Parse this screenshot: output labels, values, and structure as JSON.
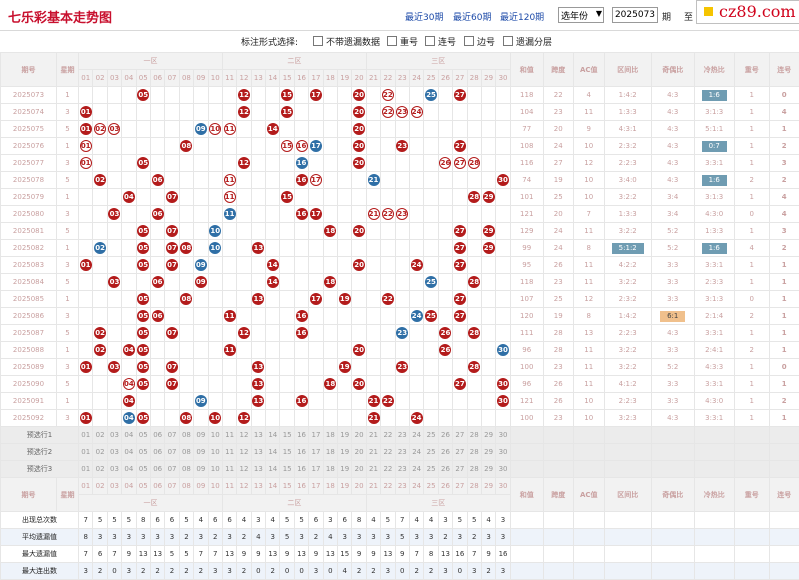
{
  "header": {
    "title": "七乐彩基本走势图",
    "links": [
      "最近30期",
      "最近60期",
      "最近120期"
    ],
    "year_select": "选年份",
    "period_value": "2025073",
    "period_unit": "期",
    "to_label": "至",
    "logo_text": "cz89.com"
  },
  "options": {
    "label": "标注形式选择:",
    "items": [
      "不带遗漏数据",
      "重号",
      "连号",
      "边号",
      "遗漏分层"
    ]
  },
  "cols": {
    "period": "期号",
    "week": "星期",
    "zone1": "一区",
    "zone2": "二区",
    "zone3": "三区",
    "sum": "和值",
    "span": "跨度",
    "ac": "AC值",
    "zone_ratio": "区间比",
    "odd_even": "奇偶比",
    "hot_cold": "冷热比",
    "repeat": "重号",
    "consec": "连号"
  },
  "numbers": [
    "01",
    "02",
    "03",
    "04",
    "05",
    "06",
    "07",
    "08",
    "09",
    "10",
    "11",
    "12",
    "13",
    "14",
    "15",
    "16",
    "17",
    "18",
    "19",
    "20",
    "21",
    "22",
    "23",
    "24",
    "25",
    "26",
    "27",
    "28",
    "29",
    "30"
  ],
  "rows": [
    {
      "p": "2025073",
      "w": "1",
      "balls": [
        5,
        12,
        15,
        17,
        20,
        22,
        27,
        25
      ],
      "blue": [
        25
      ],
      "ring": [
        22
      ],
      "sum": "118",
      "span": "22",
      "ac": "4",
      "zr": "1:4:2",
      "oe": "4:3",
      "hc": "1:6",
      "hch": 1,
      "rep": "1",
      "con": "0"
    },
    {
      "p": "2025074",
      "w": "3",
      "balls": [
        1,
        12,
        15,
        20,
        22,
        23,
        24
      ],
      "ring": [
        22,
        23,
        24
      ],
      "sum": "104",
      "span": "23",
      "ac": "11",
      "zr": "1:3:3",
      "oe": "4:3",
      "hc": "3:1:3",
      "rep": "1",
      "con": "4"
    },
    {
      "p": "2025075",
      "w": "5",
      "balls": [
        1,
        2,
        3,
        9,
        10,
        11,
        14,
        20
      ],
      "blue": [
        9
      ],
      "ring": [
        2,
        3,
        10,
        11
      ],
      "sum": "77",
      "span": "20",
      "ac": "9",
      "zr": "4:3:1",
      "oe": "4:3",
      "hc": "5:1:1",
      "rep": "1",
      "con": "1"
    },
    {
      "p": "2025076",
      "w": "1",
      "balls": [
        1,
        8,
        15,
        16,
        17,
        20,
        23,
        27
      ],
      "blue": [
        17
      ],
      "ring": [
        1,
        15,
        16
      ],
      "sum": "108",
      "span": "24",
      "ac": "10",
      "zr": "2:3:2",
      "oe": "4:3",
      "hc": "0:7",
      "hch": 1,
      "rep": "1",
      "con": "2"
    },
    {
      "p": "2025077",
      "w": "3",
      "balls": [
        1,
        5,
        12,
        16,
        20,
        26,
        27,
        28
      ],
      "blue": [
        16
      ],
      "ring": [
        1,
        26,
        27,
        28
      ],
      "sum": "116",
      "span": "27",
      "ac": "12",
      "zr": "2:2:3",
      "oe": "4:3",
      "hc": "3:3:1",
      "rep": "1",
      "con": "3"
    },
    {
      "p": "2025078",
      "w": "5",
      "balls": [
        2,
        6,
        11,
        16,
        17,
        21,
        30
      ],
      "blue": [
        21
      ],
      "ring": [
        11,
        17
      ],
      "sum": "74",
      "span": "19",
      "ac": "10",
      "zr": "3:4:0",
      "oe": "4:3",
      "hc": "1:6",
      "hch": 1,
      "rep": "2",
      "con": "2"
    },
    {
      "p": "2025079",
      "w": "1",
      "balls": [
        4,
        7,
        11,
        15,
        28,
        29
      ],
      "ring": [
        11
      ],
      "sum": "101",
      "span": "25",
      "ac": "10",
      "zr": "3:2:2",
      "oe": "3:4",
      "hc": "3:1:3",
      "rep": "1",
      "con": "4"
    },
    {
      "p": "2025080",
      "w": "3",
      "balls": [
        3,
        6,
        11,
        16,
        17,
        21,
        22,
        23
      ],
      "blue": [
        11
      ],
      "ring": [
        21,
        22,
        23
      ],
      "sum": "121",
      "span": "20",
      "ac": "7",
      "zr": "1:3:3",
      "oe": "3:4",
      "hc": "4:3:0",
      "rep": "0",
      "con": "4"
    },
    {
      "p": "2025081",
      "w": "5",
      "balls": [
        5,
        7,
        10,
        18,
        20,
        27,
        29
      ],
      "blue": [
        10
      ],
      "sum": "129",
      "span": "24",
      "ac": "11",
      "zr": "3:2:2",
      "oe": "5:2",
      "hc": "1:3:3",
      "rep": "1",
      "con": "3"
    },
    {
      "p": "2025082",
      "w": "1",
      "balls": [
        2,
        5,
        7,
        8,
        10,
        13,
        27,
        29
      ],
      "blue": [
        2,
        10
      ],
      "sum": "99",
      "span": "24",
      "ac": "8",
      "zr": "5:1:2",
      "oe": "5:2",
      "hc": "1:6",
      "hch": 1,
      "zrh": 1,
      "rep": "4",
      "con": "2"
    },
    {
      "p": "2025083",
      "w": "3",
      "balls": [
        1,
        5,
        7,
        9,
        14,
        20,
        24,
        27
      ],
      "blue": [
        9
      ],
      "sum": "95",
      "span": "26",
      "ac": "11",
      "zr": "4:2:2",
      "oe": "3:3",
      "hc": "3:3:1",
      "rep": "1",
      "con": "1"
    },
    {
      "p": "2025084",
      "w": "5",
      "balls": [
        3,
        6,
        9,
        14,
        18,
        25,
        28
      ],
      "blue": [
        25
      ],
      "sum": "118",
      "span": "23",
      "ac": "11",
      "zr": "3:2:2",
      "oe": "3:3",
      "hc": "2:3:3",
      "rep": "1",
      "con": "1"
    },
    {
      "p": "2025085",
      "w": "1",
      "balls": [
        5,
        8,
        13,
        17,
        19,
        22,
        27
      ],
      "sum": "107",
      "span": "25",
      "ac": "12",
      "zr": "2:3:2",
      "oe": "3:3",
      "hc": "3:1:3",
      "rep": "0",
      "con": "1"
    },
    {
      "p": "2025086",
      "w": "3",
      "balls": [
        5,
        6,
        11,
        16,
        24,
        25,
        27
      ],
      "blue": [
        24
      ],
      "sum": "120",
      "span": "19",
      "ac": "8",
      "zr": "1:4:2",
      "oe": "6:1",
      "oeh": 1,
      "hc": "2:1:4",
      "rep": "2",
      "con": "1"
    },
    {
      "p": "2025087",
      "w": "5",
      "balls": [
        2,
        5,
        7,
        12,
        16,
        23,
        26,
        28
      ],
      "blue": [
        23
      ],
      "sum": "111",
      "span": "28",
      "ac": "13",
      "zr": "2:2:3",
      "oe": "4:3",
      "hc": "3:3:1",
      "rep": "1",
      "con": "1"
    },
    {
      "p": "2025088",
      "w": "1",
      "balls": [
        2,
        4,
        5,
        11,
        20,
        26,
        30
      ],
      "blue": [
        30
      ],
      "sum": "96",
      "span": "28",
      "ac": "11",
      "zr": "3:2:2",
      "oe": "3:3",
      "hc": "2:4:1",
      "rep": "2",
      "con": "1"
    },
    {
      "p": "2025089",
      "w": "3",
      "balls": [
        1,
        3,
        5,
        7,
        13,
        19,
        23,
        28
      ],
      "sum": "100",
      "span": "23",
      "ac": "11",
      "zr": "3:2:2",
      "oe": "5:2",
      "hc": "4:3:3",
      "rep": "1",
      "con": "0"
    },
    {
      "p": "2025090",
      "w": "5",
      "balls": [
        4,
        5,
        7,
        13,
        18,
        20,
        27,
        30
      ],
      "ring": [
        4
      ],
      "sum": "96",
      "span": "26",
      "ac": "11",
      "zr": "4:1:2",
      "oe": "3:3",
      "hc": "3:3:1",
      "rep": "1",
      "con": "1"
    },
    {
      "p": "2025091",
      "w": "1",
      "balls": [
        4,
        9,
        13,
        16,
        21,
        22,
        30
      ],
      "blue": [
        9
      ],
      "sum": "121",
      "span": "26",
      "ac": "10",
      "zr": "2:2:3",
      "oe": "3:3",
      "hc": "4:3:0",
      "rep": "1",
      "con": "2"
    },
    {
      "p": "2025092",
      "w": "3",
      "balls": [
        1,
        4,
        5,
        8,
        10,
        12,
        21,
        24
      ],
      "blue": [
        4
      ],
      "ring": [
        4
      ],
      "sum": "100",
      "span": "23",
      "ac": "10",
      "zr": "3:2:3",
      "oe": "4:3",
      "hc": "3:3:1",
      "rep": "1",
      "con": "1"
    }
  ],
  "pre_rows": [
    "预选行1",
    "预选行2",
    "预选行3"
  ],
  "footer_rows": [
    {
      "label": "出现总次数",
      "vals": [
        "7",
        "5",
        "5",
        "5",
        "8",
        "6",
        "6",
        "5",
        "4",
        "6",
        "6",
        "4",
        "3",
        "4",
        "5",
        "5",
        "6",
        "3",
        "6",
        "8",
        "4",
        "5",
        "7",
        "4",
        "4",
        "3",
        "5",
        "5",
        "4",
        "3"
      ]
    },
    {
      "label": "平均遗漏值",
      "vals": [
        "8",
        "3",
        "3",
        "3",
        "3",
        "3",
        "3",
        "2",
        "3",
        "2",
        "3",
        "2",
        "4",
        "3",
        "5",
        "3",
        "2",
        "4",
        "3",
        "3",
        "3",
        "3",
        "5",
        "3",
        "3",
        "2",
        "3",
        "2",
        "3",
        "3"
      ]
    },
    {
      "label": "最大遗漏值",
      "vals": [
        "7",
        "6",
        "7",
        "9",
        "13",
        "13",
        "5",
        "5",
        "7",
        "7",
        "13",
        "9",
        "9",
        "13",
        "9",
        "13",
        "9",
        "13",
        "15",
        "9",
        "9",
        "13",
        "9",
        "7",
        "8",
        "13",
        "16",
        "7",
        "9",
        "16"
      ]
    },
    {
      "label": "最大连出数",
      "vals": [
        "3",
        "2",
        "0",
        "3",
        "2",
        "2",
        "2",
        "2",
        "2",
        "3",
        "3",
        "2",
        "0",
        "2",
        "0",
        "0",
        "3",
        "0",
        "4",
        "2",
        "2",
        "3",
        "0",
        "2",
        "2",
        "3",
        "0",
        "3",
        "2",
        "3"
      ]
    }
  ]
}
